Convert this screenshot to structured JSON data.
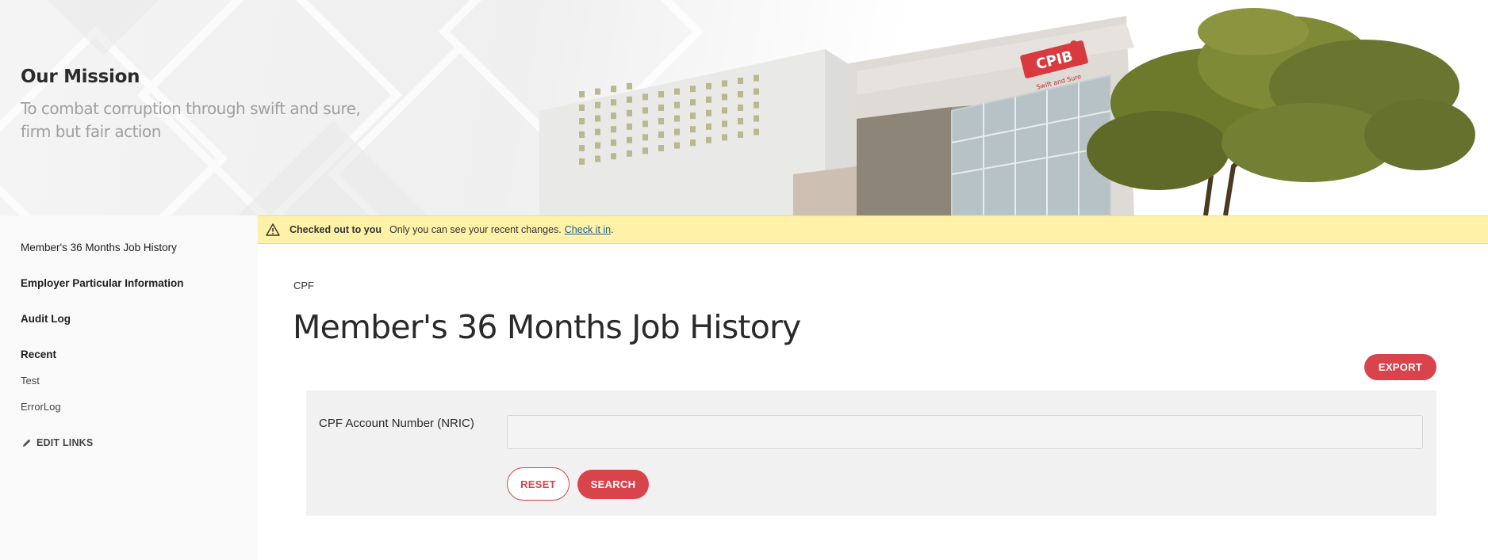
{
  "banner": {
    "mission_title": "Our Mission",
    "mission_line1": "To combat corruption through swift and sure,",
    "mission_line2": "firm but fair action",
    "sign_brand": "CPIB",
    "sign_tagline": "Swift and Sure"
  },
  "sidebar": {
    "items": [
      {
        "label": "Member's 36 Months Job History"
      },
      {
        "label": "Employer Particular Information"
      },
      {
        "label": "Audit Log"
      }
    ],
    "recent_heading": "Recent",
    "recent_items": [
      {
        "label": "Test"
      },
      {
        "label": "ErrorLog"
      }
    ],
    "edit_links_label": "EDIT LINKS",
    "edit_icon": "pencil-icon"
  },
  "notice": {
    "icon": "warning-icon",
    "title": "Checked out to you",
    "message": "Only you can see your recent changes.",
    "link_text": "Check it in",
    "suffix": "."
  },
  "main": {
    "breadcrumb": "CPF",
    "page_title": "Member's 36 Months Job History",
    "export_label": "EXPORT",
    "search": {
      "field_label": "CPF Account Number (NRIC)",
      "field_value": "",
      "reset_label": "RESET",
      "search_label": "SEARCH"
    }
  },
  "colors": {
    "accent": "#d9434b",
    "notice_bg": "#fff2a8",
    "sidebar_bg": "#f9f9f9",
    "panel_bg": "#f1f1f1"
  }
}
